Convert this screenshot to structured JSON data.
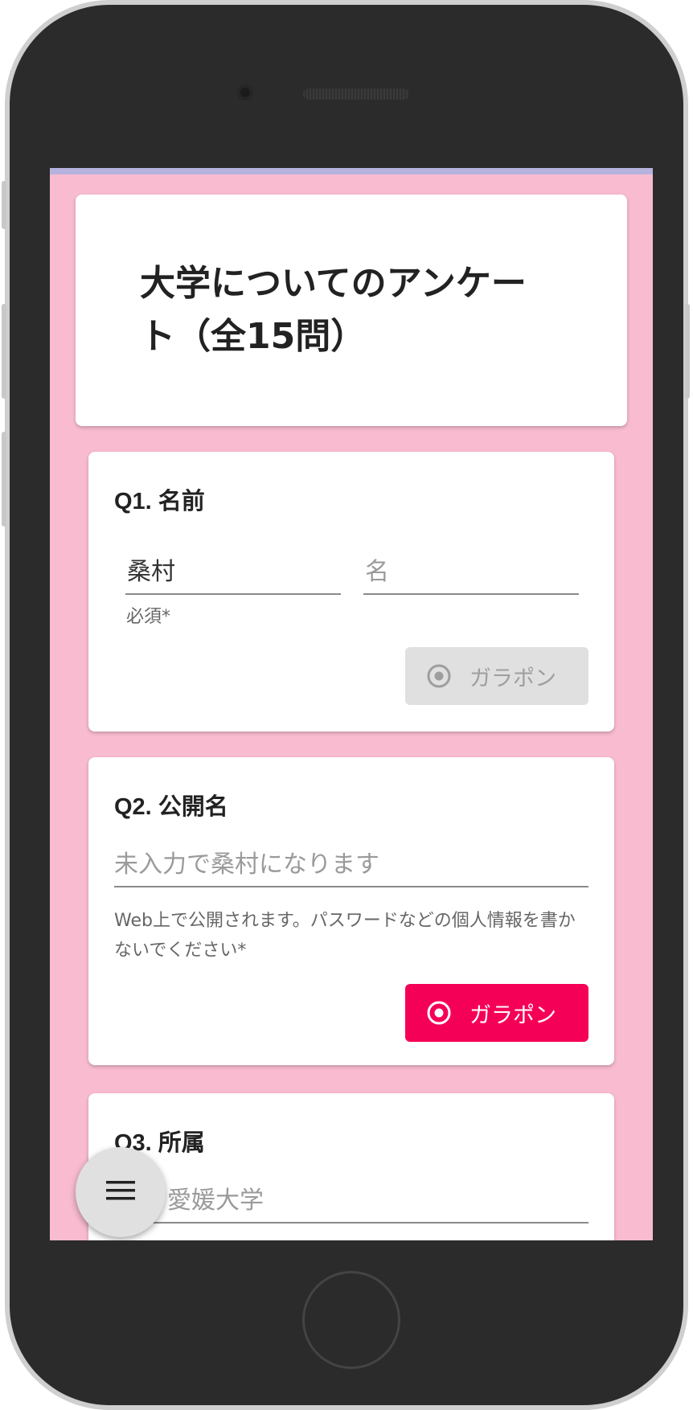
{
  "form": {
    "title": "大学についてのアンケート（全15問）"
  },
  "questions": {
    "q1": {
      "title": "Q1. 名前",
      "last_name_value": "桑村",
      "first_name_placeholder": "名",
      "helper": "必須*",
      "button_label": "ガラポン",
      "button_state": "disabled"
    },
    "q2": {
      "title": "Q2. 公開名",
      "placeholder": "未入力で桑村になります",
      "helper": "Web上で公開されます。パスワードなどの個人情報を書かないでください*",
      "button_label": "ガラポン",
      "button_state": "active"
    },
    "q3": {
      "title": "Q3. 所属",
      "placeholder": "愛媛大学"
    }
  },
  "fab": {
    "icon": "menu-icon"
  },
  "colors": {
    "background": "#f8bbd0",
    "accent": "#f50057",
    "disabled_button": "#e0e0e0",
    "top_bar": "#b5b3dd"
  },
  "icons": {
    "gara_button": "radio-target-icon"
  }
}
